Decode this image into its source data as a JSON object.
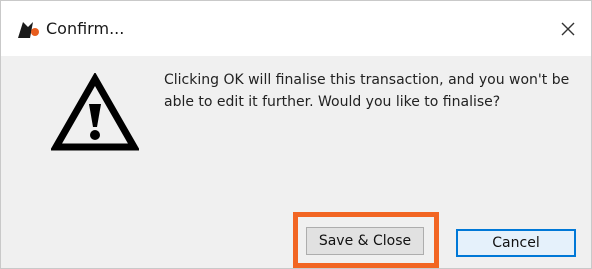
{
  "window": {
    "title": "Confirm...",
    "app_icon": "app-logo-icon",
    "close_icon": "close-icon"
  },
  "dialog": {
    "icon": "warning-icon",
    "message": "Clicking OK will finalise this transaction, and you won't be\nable to edit it further. Would you like to finalise?"
  },
  "buttons": {
    "save_close_label": "Save & Close",
    "cancel_label": "Cancel"
  },
  "colors": {
    "highlight": "#f26522",
    "focus_border": "#0078d7",
    "dialog_background": "#f0f0f0",
    "titlebar_background": "#ffffff"
  }
}
